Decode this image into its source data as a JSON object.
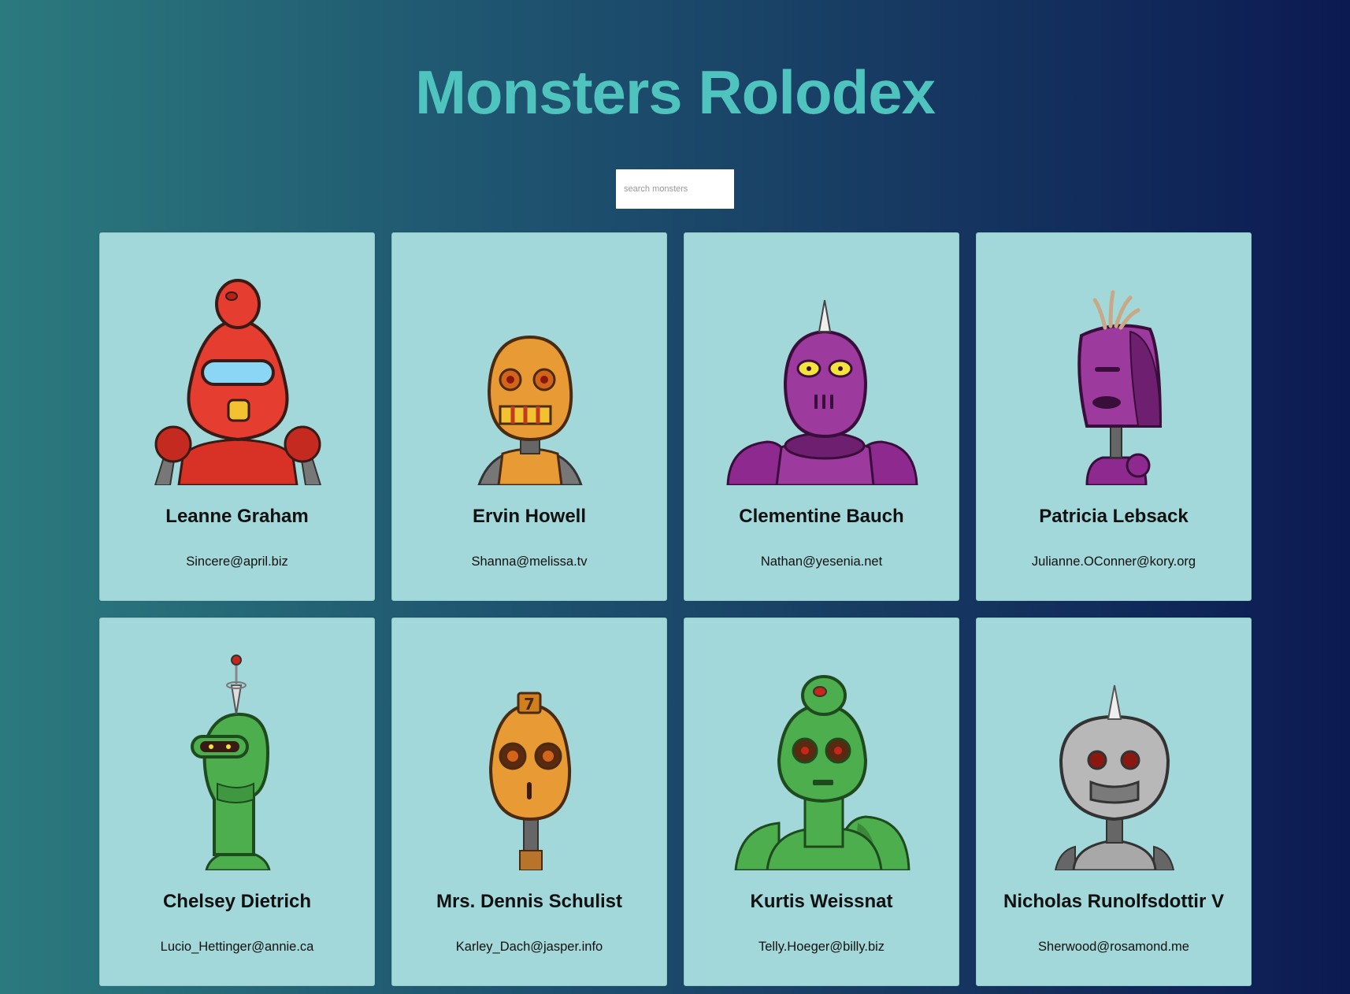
{
  "header": {
    "title": "Monsters Rolodex"
  },
  "search": {
    "placeholder": "search monsters",
    "value": ""
  },
  "monsters": [
    {
      "name": "Leanne Graham",
      "email": "Sincere@april.biz",
      "color": "#e0392d",
      "icon": "red-robot-icon"
    },
    {
      "name": "Ervin Howell",
      "email": "Shanna@melissa.tv",
      "color": "#e89a34",
      "icon": "orange-robot-icon"
    },
    {
      "name": "Clementine Bauch",
      "email": "Nathan@yesenia.net",
      "color": "#8e2a8f",
      "icon": "purple-robot-icon"
    },
    {
      "name": "Patricia Lebsack",
      "email": "Julianne.OConner@kory.org",
      "color": "#8e2a8f",
      "icon": "purple-robot-icon"
    },
    {
      "name": "Chelsey Dietrich",
      "email": "Lucio_Hettinger@annie.ca",
      "color": "#4cae4c",
      "icon": "green-robot-icon"
    },
    {
      "name": "Mrs. Dennis Schulist",
      "email": "Karley_Dach@jasper.info",
      "color": "#e89a34",
      "icon": "orange-robot-icon"
    },
    {
      "name": "Kurtis Weissnat",
      "email": "Telly.Hoeger@billy.biz",
      "color": "#4cae4c",
      "icon": "green-robot-icon"
    },
    {
      "name": "Nicholas Runolfsdottir V",
      "email": "Sherwood@rosamond.me",
      "color": "#a8a8a8",
      "icon": "gray-robot-icon"
    }
  ],
  "colors": {
    "title": "#4fc3bd",
    "card": "#a3d8da"
  }
}
